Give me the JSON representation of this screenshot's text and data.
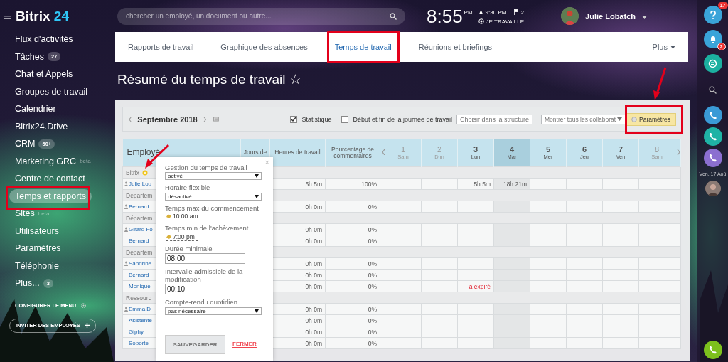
{
  "sidebar": {
    "logo": {
      "name": "Bitrix",
      "number": "24"
    },
    "items": [
      {
        "label": "Flux d'activités",
        "selected": false
      },
      {
        "label": "Tâches",
        "badge": "27",
        "selected": false
      },
      {
        "label": "Chat et Appels",
        "selected": false
      },
      {
        "label": "Groupes de travail",
        "selected": false
      },
      {
        "label": "Calendrier",
        "selected": false
      },
      {
        "label": "Bitrix24.Drive",
        "selected": false
      },
      {
        "label": "CRM",
        "badge": "50+",
        "selected": false
      },
      {
        "label": "Marketing GRC",
        "tag": "beta",
        "selected": false
      },
      {
        "label": "Centre de contact",
        "selected": false
      },
      {
        "label": "Temps et rapports",
        "selected": true
      },
      {
        "label": "Sites",
        "tag": "beta",
        "selected": false
      },
      {
        "label": "Utilisateurs",
        "selected": false
      },
      {
        "label": "Paramètres",
        "selected": false
      },
      {
        "label": "Téléphonie",
        "selected": false
      },
      {
        "label": "Plus...",
        "badge": "3",
        "selected": false
      }
    ],
    "configure": "CONFIGURER LE MENU",
    "invite": "INVITER DES EMPLOYÉS"
  },
  "topbar": {
    "search_placeholder": "chercher un employé, un document ou autre...",
    "time": "8:55",
    "ampm": "PM",
    "end_time": "9:30 PM",
    "flags": "2",
    "status": "JE TRAVAILLE",
    "user": "Julie Lobatch"
  },
  "tabs": [
    {
      "label": "Rapports de travail",
      "selected": false
    },
    {
      "label": "Graphique des absences",
      "selected": false
    },
    {
      "label": "Temps de travail",
      "selected": true
    },
    {
      "label": "Réunions et briefings",
      "selected": false
    }
  ],
  "tabs_more": "Plus",
  "page_title": "Résumé du temps de travail ☆",
  "toolbar": {
    "month": "Septembre 2018",
    "checks": [
      {
        "label": "Statistique",
        "checked": true
      },
      {
        "label": "Début et fin de la journée de travail",
        "checked": false
      }
    ],
    "selects": [
      "Choisir dans la structure",
      "Montrer tous les collaborat"
    ],
    "settings": "Paramètres"
  },
  "table": {
    "columns": [
      "Employé",
      "Jours de",
      "Heures de travail",
      "Pourcentage de commentaires"
    ],
    "days": [
      {
        "num": "1",
        "dow": "Sam",
        "weekend": true,
        "today": false
      },
      {
        "num": "2",
        "dow": "Dim",
        "weekend": true,
        "today": false
      },
      {
        "num": "3",
        "dow": "Lun",
        "weekend": false,
        "today": false
      },
      {
        "num": "4",
        "dow": "Mar",
        "weekend": false,
        "today": true
      },
      {
        "num": "5",
        "dow": "Mer",
        "weekend": false,
        "today": false
      },
      {
        "num": "6",
        "dow": "Jeu",
        "weekend": false,
        "today": false
      },
      {
        "num": "7",
        "dow": "Ven",
        "weekend": false,
        "today": false
      },
      {
        "num": "8",
        "dow": "Sam",
        "weekend": true,
        "today": false
      }
    ],
    "rows": [
      {
        "kind": "group",
        "label": "Bitrix",
        "gear": true
      },
      {
        "kind": "employee",
        "name": "Julie Lob",
        "head": true,
        "hours": "5h 5m",
        "percent": "100%",
        "day_values": {
          "3": "5h 5m",
          "4": "18h 21m"
        }
      },
      {
        "kind": "group",
        "label": "Départem"
      },
      {
        "kind": "employee",
        "name": "Bernard",
        "head": true,
        "hours": "0h 0m",
        "percent": "0%"
      },
      {
        "kind": "group",
        "label": "Départem"
      },
      {
        "kind": "employee",
        "name": "Girard Fo",
        "head": true,
        "hours": "0h 0m",
        "percent": "0%"
      },
      {
        "kind": "employee",
        "name": "Bernard",
        "head": false,
        "hours": "0h 0m",
        "percent": "0%"
      },
      {
        "kind": "group",
        "label": "Départem"
      },
      {
        "kind": "employee",
        "name": "Sandrine",
        "head": true,
        "hours": "0h 0m",
        "percent": "0%"
      },
      {
        "kind": "employee",
        "name": "Bernard",
        "head": false,
        "hours": "0h 0m",
        "percent": "0%"
      },
      {
        "kind": "employee",
        "name": "Monique",
        "head": false,
        "hours": "0h 0m",
        "percent": "0%",
        "expired_days": {
          "3": "a expiré"
        }
      },
      {
        "kind": "group",
        "label": "Ressourc"
      },
      {
        "kind": "employee",
        "name": "Emma D",
        "head": true,
        "hours": "0h 0m",
        "percent": "0%"
      },
      {
        "kind": "employee",
        "name": "Asistente",
        "head": false,
        "hours": "0h 0m",
        "percent": "0%"
      },
      {
        "kind": "employee",
        "name": "Giphy",
        "head": false,
        "hours": "0h 0m",
        "percent": "0%"
      },
      {
        "kind": "employee",
        "name": "Soporte",
        "head": false,
        "hours": "0h 0m",
        "percent": "0%"
      }
    ]
  },
  "popup": {
    "close": "×",
    "fields": [
      {
        "kind": "select",
        "label": "Gestion du temps de travail",
        "value": "activé"
      },
      {
        "kind": "select",
        "label": "Horaire flexible",
        "value": "désactivé"
      },
      {
        "kind": "time",
        "label": "Temps max du commencement",
        "value": "10:00 am"
      },
      {
        "kind": "time",
        "label": "Temps min de l'achèvement",
        "value": "7:00 pm"
      },
      {
        "kind": "input",
        "label": "Durée minimale",
        "value": "08:00"
      },
      {
        "kind": "input",
        "label": "Intervalle admissible de la modification",
        "value": "00:10"
      },
      {
        "kind": "select",
        "label": "Compte-rendu quotidien",
        "value": "pas nécessaire"
      }
    ],
    "save": "SAUVEGARDER",
    "close_link": "FERMER"
  },
  "rightbar": {
    "help_badge": "17",
    "notif_badge": "2",
    "calls": [
      {
        "color": "#3a9ad6"
      },
      {
        "color": "#1fb3a5"
      },
      {
        "color": "#8b6fd0"
      }
    ],
    "date": "Ven. 17 Aoû"
  }
}
